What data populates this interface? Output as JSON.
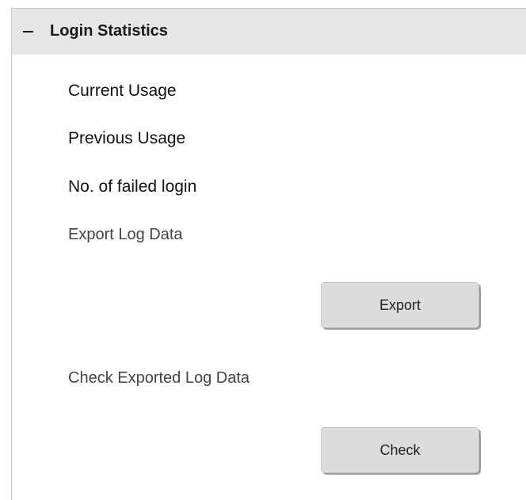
{
  "section": {
    "collapse_symbol": "−",
    "title": "Login Statistics"
  },
  "items": [
    {
      "label": "Current Usage"
    },
    {
      "label": "Previous Usage"
    },
    {
      "label": "No. of failed login"
    }
  ],
  "export": {
    "label": "Export Log Data",
    "button_label": "Export"
  },
  "check": {
    "label": "Check Exported Log Data",
    "button_label": "Check"
  },
  "colors": {
    "header_bg": "#e6e6e6",
    "button_bg": "#dcdcdc",
    "text": "#111111",
    "muted_text": "#444444"
  }
}
